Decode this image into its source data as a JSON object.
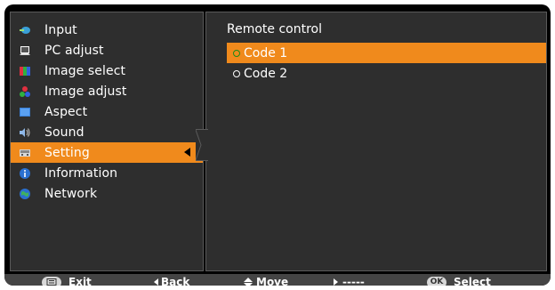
{
  "menu": {
    "items": [
      {
        "label": "Input",
        "icon": "input-icon"
      },
      {
        "label": "PC adjust",
        "icon": "pc-adjust-icon"
      },
      {
        "label": "Image select",
        "icon": "image-select-icon"
      },
      {
        "label": "Image adjust",
        "icon": "image-adjust-icon"
      },
      {
        "label": "Aspect",
        "icon": "aspect-icon"
      },
      {
        "label": "Sound",
        "icon": "sound-icon"
      },
      {
        "label": "Setting",
        "icon": "setting-icon",
        "selected": true
      },
      {
        "label": "Information",
        "icon": "information-icon"
      },
      {
        "label": "Network",
        "icon": "network-icon"
      }
    ]
  },
  "submenu": {
    "title": "Remote control",
    "options": [
      {
        "label": "Code 1",
        "selected": true
      },
      {
        "label": "Code 2",
        "selected": false
      }
    ]
  },
  "footer": {
    "exit_key": "",
    "exit_label": "Exit",
    "back_label": "Back",
    "move_label": "Move",
    "next_label": "-----",
    "ok_key": "OK",
    "select_label": "Select"
  },
  "colors": {
    "highlight": "#f08a1c",
    "panel": "#2e2e2e",
    "background": "#000000",
    "footer": "#444444"
  }
}
